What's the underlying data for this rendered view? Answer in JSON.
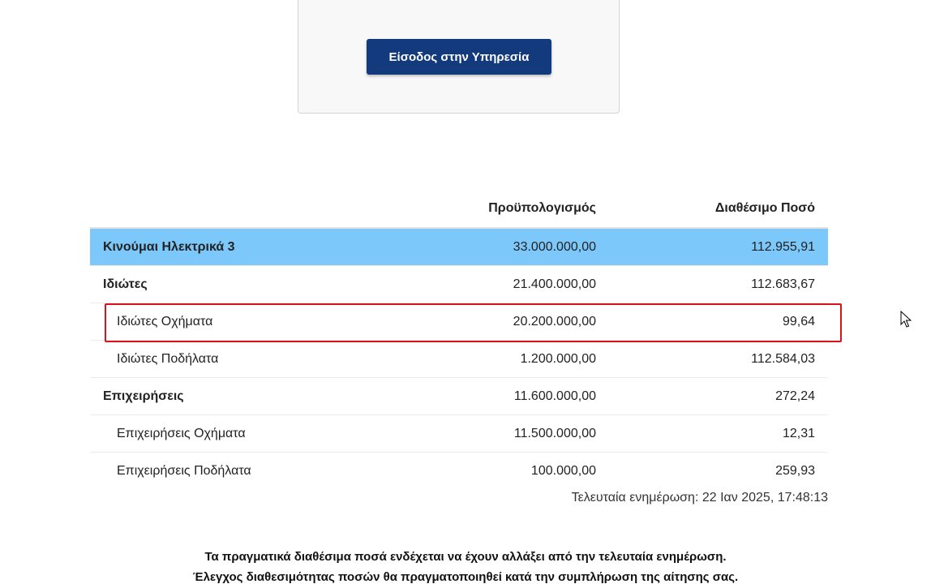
{
  "login": {
    "button_label": "Είσοδος στην Υπηρεσία"
  },
  "table": {
    "headers": [
      "",
      "Προϋπολογισμός",
      "Διαθέσιμο Ποσό"
    ],
    "rows": [
      {
        "label": "Κινούμαι Ηλεκτρικά 3",
        "budget": "33.000.000,00",
        "available": "112.955,91"
      },
      {
        "label": "Ιδιώτες",
        "budget": "21.400.000,00",
        "available": "112.683,67"
      },
      {
        "label": "Ιδιώτες Οχήματα",
        "budget": "20.200.000,00",
        "available": "99,64"
      },
      {
        "label": "Ιδιώτες Ποδήλατα",
        "budget": "1.200.000,00",
        "available": "112.584,03"
      },
      {
        "label": "Επιχειρήσεις",
        "budget": "11.600.000,00",
        "available": "272,24"
      },
      {
        "label": "Επιχειρήσεις Οχήματα",
        "budget": "11.500.000,00",
        "available": "12,31"
      },
      {
        "label": "Επιχειρήσεις Ποδήλατα",
        "budget": "100.000,00",
        "available": "259,93"
      }
    ]
  },
  "last_update": "Τελευταία ενημέρωση: 22 Ιαν 2025, 17:48:13",
  "notes": [
    "Τα πραγματικά διαθέσιμα ποσά ενδέχεται να έχουν αλλάξει από την τελευταία ενημέρωση.",
    "Έλεγχος διαθεσιμότητας ποσών θα πραγματοποιηθεί κατά την συμπλήρωση της αίτησης σας."
  ],
  "colors": {
    "button": "#133a7c",
    "program_row": "#7cc8fb",
    "highlight": "#d9131b"
  },
  "icons": {
    "logo_fragment": "logo-icon",
    "cursor": "mouse-cursor-icon"
  }
}
